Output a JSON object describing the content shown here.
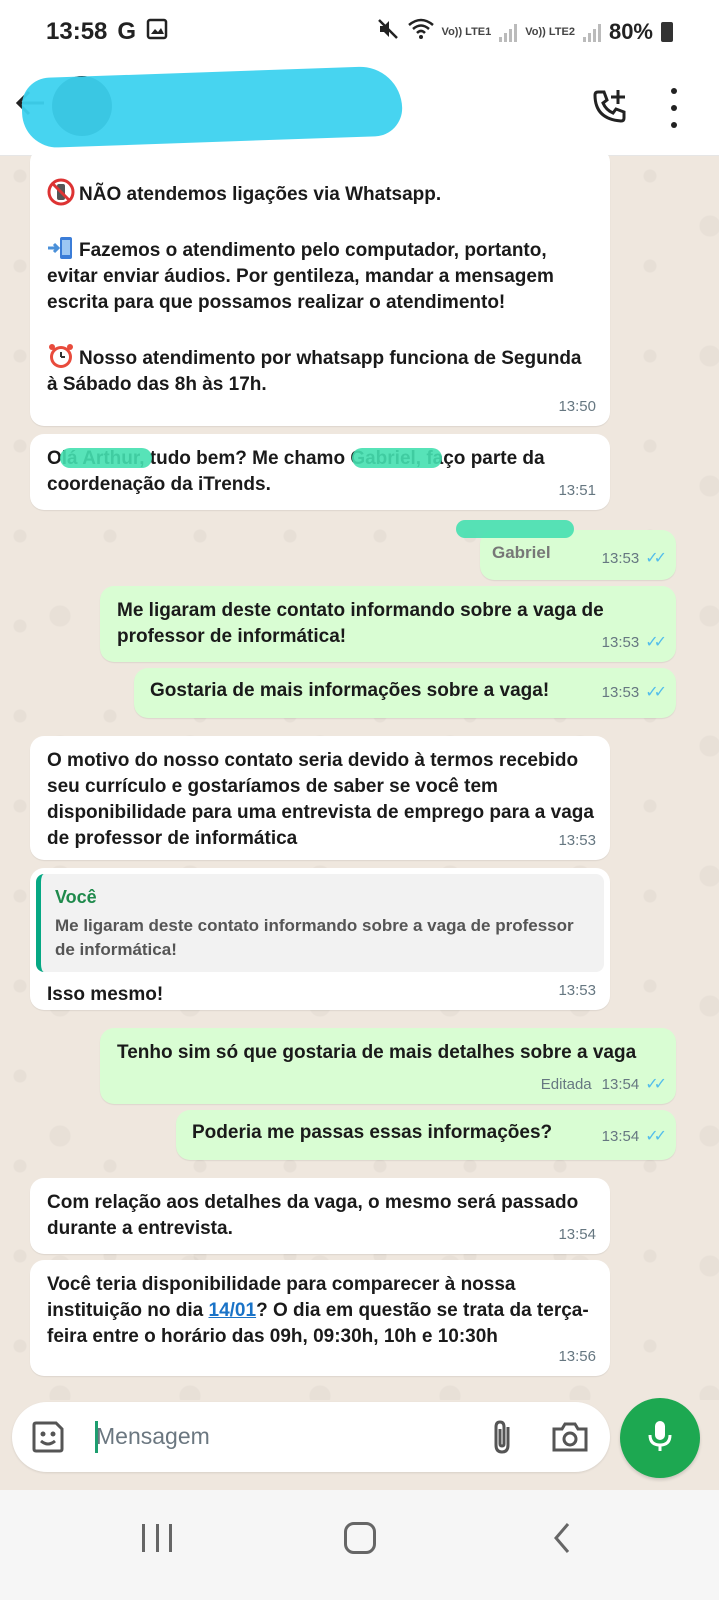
{
  "status_bar": {
    "time": "13:58",
    "g_indicator": "G",
    "lte1": "Vo)) LTE1",
    "lte2": "Vo)) LTE2",
    "battery": "80%"
  },
  "header": {
    "contact_name": "",
    "icons": [
      "back-arrow-icon",
      "add-call-icon",
      "more-vert-icon"
    ]
  },
  "messages": [
    {
      "direction": "in",
      "paragraphs": [
        "NÃO atendemos ligações via Whatsapp.",
        "Fazemos o atendimento pelo computador, portanto, evitar enviar áudios. Por gentileza, mandar a mensagem escrita para que possamos realizar o atendimento!",
        "Nosso atendimento por whatsapp funciona de Segunda à Sábado das 8h às 17h."
      ],
      "time": "13:50"
    },
    {
      "direction": "in",
      "text": "Olá Arthur, tudo bem? Me chamo Gabriel, faço parte da coordenação da iTrends.",
      "time": "13:51"
    },
    {
      "direction": "out",
      "text": "Gabriel",
      "time": "13:53"
    },
    {
      "direction": "out",
      "text": "Me ligaram deste contato informando sobre a vaga de professor de informática!",
      "time": "13:53"
    },
    {
      "direction": "out",
      "text": "Gostaria de mais informações sobre a vaga!",
      "time": "13:53"
    },
    {
      "direction": "in",
      "text": "O motivo do nosso contato seria devido à termos recebido seu currículo e gostaríamos de saber se você tem disponibilidade para uma entrevista de emprego para a vaga de professor de informática",
      "time": "13:53"
    },
    {
      "direction": "in",
      "quote_author": "Você",
      "quote_text": "Me ligaram deste contato informando sobre a vaga de professor de informática!",
      "text": "Isso mesmo!",
      "time": "13:53"
    },
    {
      "direction": "out",
      "text": "Tenho sim só que gostaria de mais detalhes sobre a vaga",
      "edited_label": "Editada",
      "time": "13:54"
    },
    {
      "direction": "out",
      "text": "Poderia me passas essas informações?",
      "time": "13:54"
    },
    {
      "direction": "in",
      "text": "Com relação aos detalhes da vaga, o mesmo será passado durante a entrevista.",
      "time": "13:54"
    },
    {
      "direction": "in",
      "text_before_link": "Você teria disponibilidade para comparecer à nossa instituição no dia ",
      "link_text": "14/01",
      "text_after_link": "? O dia em questão se trata da terça-feira entre o horário das 09h, 09:30h, 10h e 10:30h",
      "time": "13:56"
    }
  ],
  "input": {
    "placeholder": "Mensagem"
  },
  "ticks": "✓✓",
  "colors": {
    "outgoing_bubble": "#d9fdd3",
    "incoming_bubble": "#ffffff",
    "accent_green": "#1da851",
    "read_ticks": "#53bdeb",
    "chat_background": "#efe7de"
  }
}
